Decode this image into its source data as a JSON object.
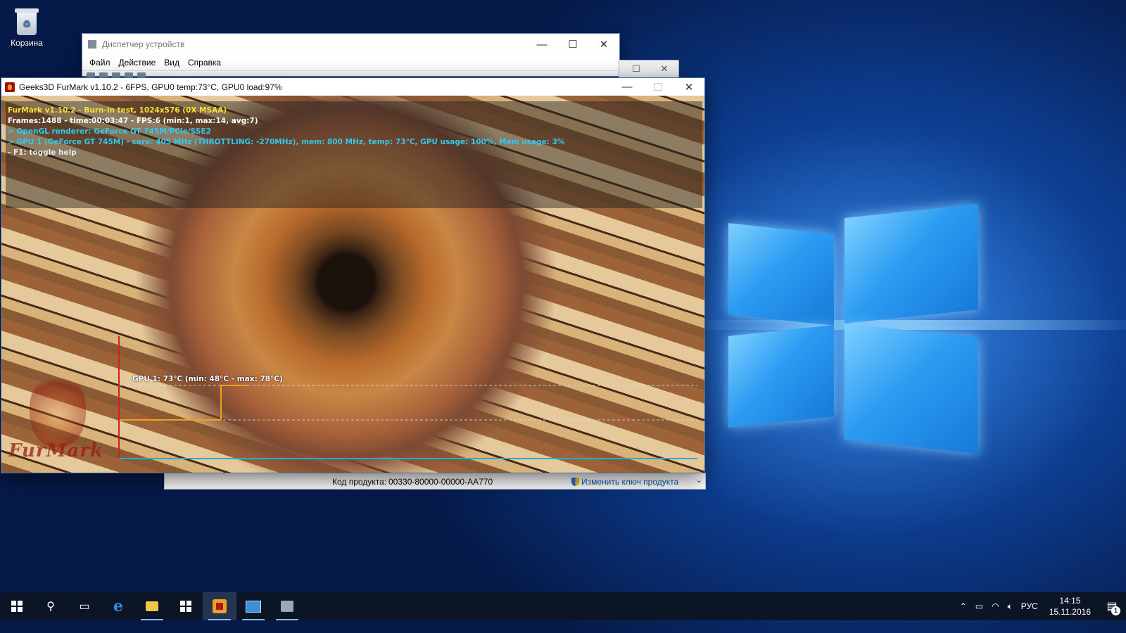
{
  "desktop": {
    "icons": [
      {
        "label": "Корзина"
      }
    ]
  },
  "device_manager": {
    "title": "Диспетчер устройств",
    "menu": [
      "Файл",
      "Действие",
      "Вид",
      "Справка"
    ]
  },
  "system_properties": {
    "product_key_label": "Код продукта:",
    "product_key_value": "00330-80000-00000-AA770",
    "change_key_link": "Изменить ключ продукта"
  },
  "furmark": {
    "title": "Geeks3D FurMark v1.10.2 - 6FPS, GPU0 temp:73°C, GPU0 load:97%",
    "hud": {
      "line1": "FurMark v1.10.2 - Burn-in test, 1024x576 (0X MSAA)",
      "line2": "Frames:1488 - time:00:03:47 - FPS:6 (min:1, max:14, avg:7)",
      "line3": "> OpenGL renderer: GeForce GT 745M/PCIe/SSE2",
      "line4": "> GPU 1 (GeForce GT 745M) - core: 405 MHz (THROTTLING: -270MHz), mem: 800 MHz, temp: 73°C, GPU usage: 100%, Mem usage: 3%",
      "line5": "- F1: toggle help"
    },
    "temp_label": "GPU 1: 73°C (min: 48°C - max: 78°C)",
    "logo_text": "FurMark",
    "graph_colors": {
      "axis": "#cc2222",
      "frame": "#2aa8d8",
      "trace": "#f0a020"
    }
  },
  "taskbar": {
    "buttons": [
      {
        "name": "start",
        "icon": "windows-logo-icon"
      },
      {
        "name": "search",
        "icon": "search-icon"
      },
      {
        "name": "task-view",
        "icon": "task-view-icon"
      },
      {
        "name": "edge",
        "icon": "edge-icon"
      },
      {
        "name": "explorer",
        "icon": "folder-icon"
      },
      {
        "name": "store",
        "icon": "store-icon"
      },
      {
        "name": "furmark",
        "icon": "furmark-icon"
      },
      {
        "name": "system",
        "icon": "system-icon"
      },
      {
        "name": "device-manager",
        "icon": "device-manager-icon"
      }
    ],
    "tray": {
      "language": "РУС",
      "time": "14:15",
      "date": "15.11.2016",
      "notification_count": "1"
    }
  }
}
